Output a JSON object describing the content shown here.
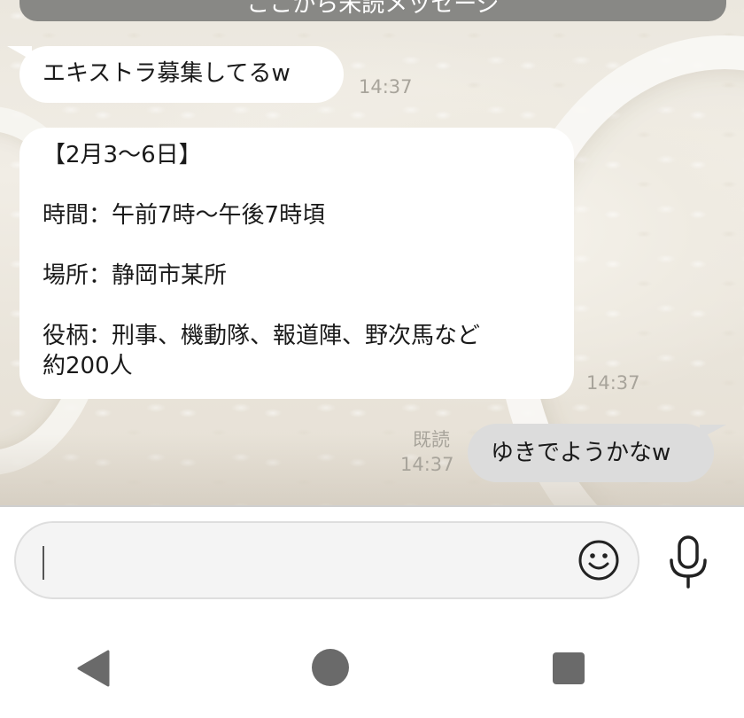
{
  "banner": {
    "text": "ここから未読メッセージ"
  },
  "messages": [
    {
      "side": "received",
      "lines": [
        "エキストラ募集してるw"
      ],
      "time": "14:37"
    },
    {
      "side": "received",
      "lines": [
        "【2月3〜6日】",
        "",
        "時間：午前7時〜午後7時頃",
        "",
        "場所：静岡市某所",
        "",
        "役柄：刑事、機動隊、報道陣、野次馬など",
        "約200人"
      ],
      "time": "14:37"
    },
    {
      "side": "sent",
      "lines": [
        "ゆきでようかなw"
      ],
      "read_label": "既読",
      "time": "14:37"
    }
  ],
  "input": {
    "value": "",
    "emoji_icon": "smiley-icon",
    "mic_icon": "microphone-icon"
  },
  "navbar": {
    "back_icon": "back-triangle-icon",
    "home_icon": "home-circle-icon",
    "recent_icon": "recent-apps-square-icon"
  },
  "colors": {
    "received_bubble": "#ffffff",
    "sent_bubble": "#dcdcdc",
    "timestamp": "#a8a49b",
    "banner_bg": "#888885"
  }
}
